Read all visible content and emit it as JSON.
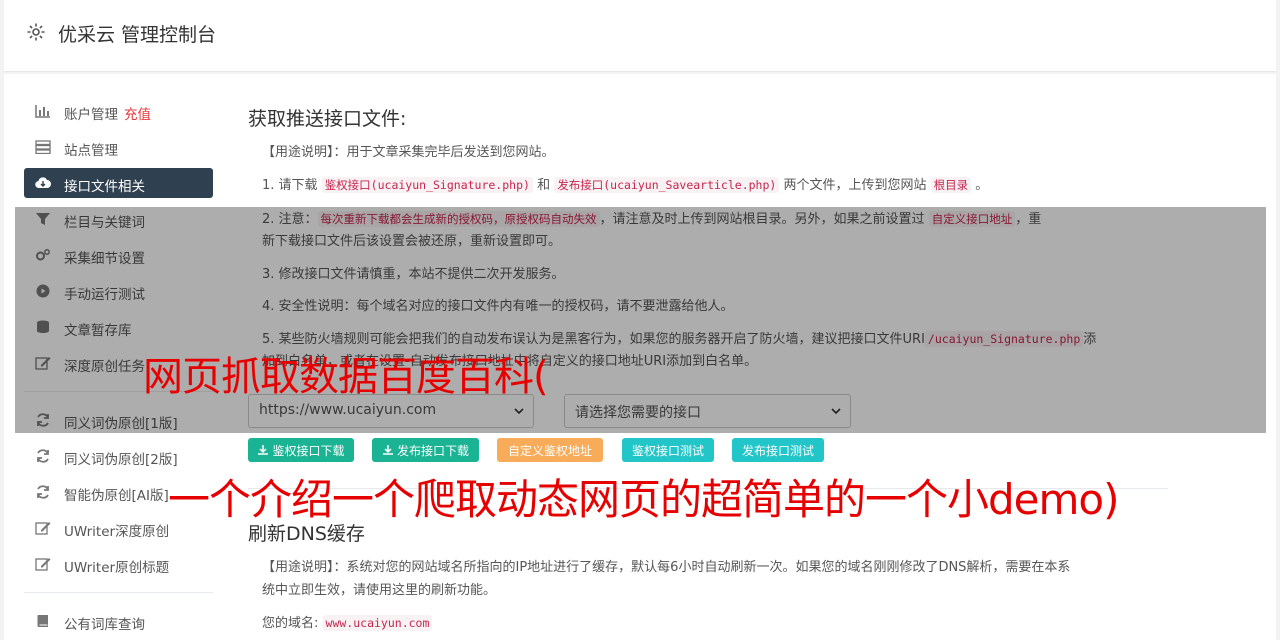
{
  "header": {
    "title": "优采云 管理控制台"
  },
  "sidebar": {
    "items": [
      {
        "label": "账户管理",
        "extra": "充值",
        "icon": "bar-chart-icon"
      },
      {
        "label": "站点管理",
        "icon": "server-icon"
      },
      {
        "label": "接口文件相关",
        "icon": "cloud-download-icon"
      },
      {
        "label": "栏目与关键词",
        "icon": "filter-icon"
      },
      {
        "label": "采集细节设置",
        "icon": "cogs-icon"
      },
      {
        "label": "手动运行测试",
        "icon": "play-circle-icon"
      },
      {
        "label": "文章暂存库",
        "icon": "database-icon"
      },
      {
        "label": "深度原创任务",
        "icon": "edit-icon"
      },
      {
        "label": "同义词伪原创[1版]",
        "icon": "refresh-icon"
      },
      {
        "label": "同义词伪原创[2版]",
        "icon": "refresh-icon"
      },
      {
        "label": "智能伪原创[AI版]",
        "icon": "refresh-icon"
      },
      {
        "label": "UWriter深度原创",
        "icon": "edit-icon"
      },
      {
        "label": "UWriter原创标题",
        "icon": "edit-icon"
      },
      {
        "label": "公有词库查询",
        "icon": "book-icon"
      }
    ]
  },
  "main": {
    "section1": {
      "heading": "获取推送接口文件:",
      "usage": "【用途说明】：用于文章采集完毕后发送到您网站。",
      "step1": {
        "a": "1. 请下载",
        "code1": "鉴权接口(ucaiyun_Signature.php)",
        "b": "和",
        "code2": "发布接口(ucaiyun_Savearticle.php)",
        "c": "两个文件，上传到您网站",
        "code3": "根目录",
        "d": "。"
      },
      "step2": {
        "a": "2. 注意：",
        "code1": "每次重新下载都会生成新的授权码，原授权码自动失效",
        "b": "，请注意及时上传到网站根目录。另外，如果之前设置过",
        "code2": "自定义接口地址",
        "c": "，重",
        "line2": "新下载接口文件后该设置会被还原，重新设置即可。"
      },
      "step3": "3. 修改接口文件请慎重，本站不提供二次开发服务。",
      "step4": "4. 安全性说明：每个域名对应的接口文件内有唯一的授权码，请不要泄露给他人。",
      "step5": {
        "a": "5. 某些防火墙规则可能会把我们的自动发布误认为是黑客行为，如果您的服务器开启了防火墙，建议把接口文件URI",
        "code1": "/ucaiyun_Signature.php",
        "b": "添",
        "line2": "加到白名单，或者在设置-自动发布接口地址中将自定义的接口地址URI添加到白名单。"
      },
      "site_select": "https://www.ucaiyun.com",
      "api_select": "请选择您需要的接口",
      "buttons": {
        "download_sign": "鉴权接口下载",
        "download_publish": "发布接口下载",
        "custom_sign": "自定义鉴权地址",
        "test_sign": "鉴权接口测试",
        "test_publish": "发布接口测试"
      }
    },
    "section2": {
      "heading": "刷新DNS缓存",
      "usage_line1": "【用途说明】：系统对您的网站域名所指向的IP地址进行了缓存，默认每6小时自动刷新一次。如果您的域名刚刚修改了DNS解析，需要在本系",
      "usage_line2": "统中立即生效，请使用这里的刷新功能。",
      "domain_label": "您的域名:",
      "domain_value": "www.ucaiyun.com"
    }
  },
  "overlay_text": {
    "line1": "网页抓取数据百度百科(",
    "line2": "一个介绍一个爬取动态网页的超简单的一个小demo)"
  },
  "colors": {
    "active_nav": "#2f4050",
    "green": "#1ab394",
    "orange": "#f8ac59",
    "blue": "#23c6c8",
    "red": "#e60000"
  }
}
